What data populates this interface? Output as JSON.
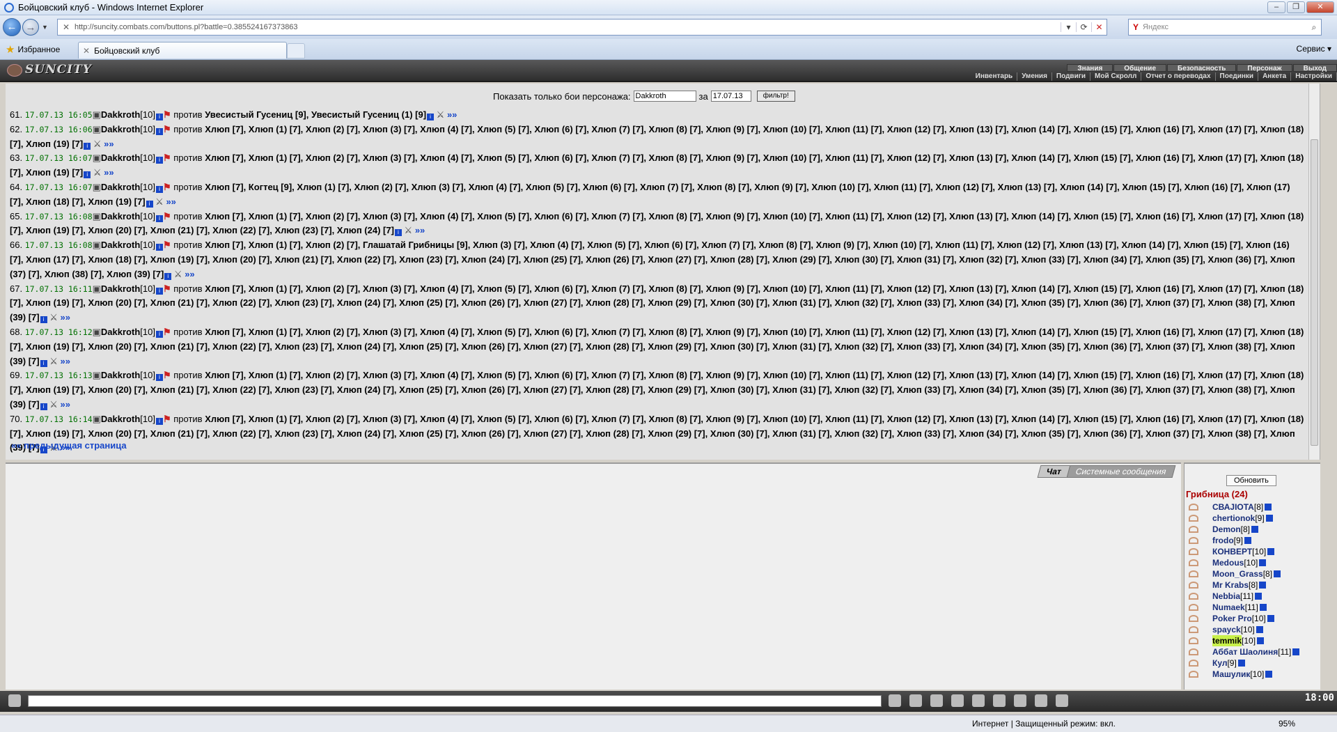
{
  "window": {
    "title": "Бойцовский клуб - Windows Internet Explorer"
  },
  "address": {
    "url": "http://suncity.combats.com/buttons.pl?battle=0.385524167373863"
  },
  "search": {
    "placeholder": "Яндекс"
  },
  "favorites": {
    "label": "Избранное"
  },
  "tab": {
    "title": "Бойцовский клуб"
  },
  "service_menu": "Сервис",
  "game": {
    "logo": "SUNCITY",
    "menu_top": [
      "Знания",
      "Общение",
      "Безопасность",
      "Персонаж",
      "Выход"
    ],
    "menu_bottom": [
      "Инвентарь",
      "Умения",
      "Подвиги",
      "Мой Скролл",
      "Отчет о переводах",
      "Поединки",
      "Анкета",
      "Настройки"
    ]
  },
  "filter": {
    "label": "Показать только бои персонажа:",
    "name": "Dakkroth",
    "for_label": "за",
    "date": "17.07.13",
    "button": "фильтр!"
  },
  "battles": [
    {
      "n": "61.",
      "dt": "17.07.13 16:05",
      "text": "Увесистый Гусениц [9], Увесистый Гусениц (1) [9]"
    },
    {
      "n": "62.",
      "dt": "17.07.13 16:06",
      "text": "Хлюп [7], Хлюп (1) [7], Хлюп (2) [7], Хлюп (3) [7], Хлюп (4) [7], Хлюп (5) [7], Хлюп (6) [7], Хлюп (7) [7], Хлюп (8) [7], Хлюп (9) [7], Хлюп (10) [7], Хлюп (11) [7], Хлюп (12) [7], Хлюп (13) [7], Хлюп (14) [7], Хлюп (15) [7], Хлюп (16) [7], Хлюп (17) [7], Хлюп (18) [7], Хлюп (19) [7]"
    },
    {
      "n": "63.",
      "dt": "17.07.13 16:07",
      "text": "Хлюп [7], Хлюп (1) [7], Хлюп (2) [7], Хлюп (3) [7], Хлюп (4) [7], Хлюп (5) [7], Хлюп (6) [7], Хлюп (7) [7], Хлюп (8) [7], Хлюп (9) [7], Хлюп (10) [7], Хлюп (11) [7], Хлюп (12) [7], Хлюп (13) [7], Хлюп (14) [7], Хлюп (15) [7], Хлюп (16) [7], Хлюп (17) [7], Хлюп (18) [7], Хлюп (19) [7]"
    },
    {
      "n": "64.",
      "dt": "17.07.13 16:07",
      "text": "Хлюп [7], Когтец [9], Хлюп (1) [7], Хлюп (2) [7], Хлюп (3) [7], Хлюп (4) [7], Хлюп (5) [7], Хлюп (6) [7], Хлюп (7) [7], Хлюп (8) [7], Хлюп (9) [7], Хлюп (10) [7], Хлюп (11) [7], Хлюп (12) [7], Хлюп (13) [7], Хлюп (14) [7], Хлюп (15) [7], Хлюп (16) [7], Хлюп (17) [7], Хлюп (18) [7], Хлюп (19) [7]"
    },
    {
      "n": "65.",
      "dt": "17.07.13 16:08",
      "text": "Хлюп [7], Хлюп (1) [7], Хлюп (2) [7], Хлюп (3) [7], Хлюп (4) [7], Хлюп (5) [7], Хлюп (6) [7], Хлюп (7) [7], Хлюп (8) [7], Хлюп (9) [7], Хлюп (10) [7], Хлюп (11) [7], Хлюп (12) [7], Хлюп (13) [7], Хлюп (14) [7], Хлюп (15) [7], Хлюп (16) [7], Хлюп (17) [7], Хлюп (18) [7], Хлюп (19) [7], Хлюп (20) [7], Хлюп (21) [7], Хлюп (22) [7], Хлюп (23) [7], Хлюп (24) [7]"
    },
    {
      "n": "66.",
      "dt": "17.07.13 16:08",
      "text": "Хлюп [7], Хлюп (1) [7], Хлюп (2) [7], Глашатай Грибницы [9], Хлюп (3) [7], Хлюп (4) [7], Хлюп (5) [7], Хлюп (6) [7], Хлюп (7) [7], Хлюп (8) [7], Хлюп (9) [7], Хлюп (10) [7], Хлюп (11) [7], Хлюп (12) [7], Хлюп (13) [7], Хлюп (14) [7], Хлюп (15) [7], Хлюп (16) [7], Хлюп (17) [7], Хлюп (18) [7], Хлюп (19) [7], Хлюп (20) [7], Хлюп (21) [7], Хлюп (22) [7], Хлюп (23) [7], Хлюп (24) [7], Хлюп (25) [7], Хлюп (26) [7], Хлюп (27) [7], Хлюп (28) [7], Хлюп (29) [7], Хлюп (30) [7], Хлюп (31) [7], Хлюп (32) [7], Хлюп (33) [7], Хлюп (34) [7], Хлюп (35) [7], Хлюп (36) [7], Хлюп (37) [7], Хлюп (38) [7], Хлюп (39) [7]"
    },
    {
      "n": "67.",
      "dt": "17.07.13 16:11",
      "text": "Хлюп [7], Хлюп (1) [7], Хлюп (2) [7], Хлюп (3) [7], Хлюп (4) [7], Хлюп (5) [7], Хлюп (6) [7], Хлюп (7) [7], Хлюп (8) [7], Хлюп (9) [7], Хлюп (10) [7], Хлюп (11) [7], Хлюп (12) [7], Хлюп (13) [7], Хлюп (14) [7], Хлюп (15) [7], Хлюп (16) [7], Хлюп (17) [7], Хлюп (18) [7], Хлюп (19) [7], Хлюп (20) [7], Хлюп (21) [7], Хлюп (22) [7], Хлюп (23) [7], Хлюп (24) [7], Хлюп (25) [7], Хлюп (26) [7], Хлюп (27) [7], Хлюп (28) [7], Хлюп (29) [7], Хлюп (30) [7], Хлюп (31) [7], Хлюп (32) [7], Хлюп (33) [7], Хлюп (34) [7], Хлюп (35) [7], Хлюп (36) [7], Хлюп (37) [7], Хлюп (38) [7], Хлюп (39) [7]"
    },
    {
      "n": "68.",
      "dt": "17.07.13 16:12",
      "text": "Хлюп [7], Хлюп (1) [7], Хлюп (2) [7], Хлюп (3) [7], Хлюп (4) [7], Хлюп (5) [7], Хлюп (6) [7], Хлюп (7) [7], Хлюп (8) [7], Хлюп (9) [7], Хлюп (10) [7], Хлюп (11) [7], Хлюп (12) [7], Хлюп (13) [7], Хлюп (14) [7], Хлюп (15) [7], Хлюп (16) [7], Хлюп (17) [7], Хлюп (18) [7], Хлюп (19) [7], Хлюп (20) [7], Хлюп (21) [7], Хлюп (22) [7], Хлюп (23) [7], Хлюп (24) [7], Хлюп (25) [7], Хлюп (26) [7], Хлюп (27) [7], Хлюп (28) [7], Хлюп (29) [7], Хлюп (30) [7], Хлюп (31) [7], Хлюп (32) [7], Хлюп (33) [7], Хлюп (34) [7], Хлюп (35) [7], Хлюп (36) [7], Хлюп (37) [7], Хлюп (38) [7], Хлюп (39) [7]"
    },
    {
      "n": "69.",
      "dt": "17.07.13 16:13",
      "text": "Хлюп [7], Хлюп (1) [7], Хлюп (2) [7], Хлюп (3) [7], Хлюп (4) [7], Хлюп (5) [7], Хлюп (6) [7], Хлюп (7) [7], Хлюп (8) [7], Хлюп (9) [7], Хлюп (10) [7], Хлюп (11) [7], Хлюп (12) [7], Хлюп (13) [7], Хлюп (14) [7], Хлюп (15) [7], Хлюп (16) [7], Хлюп (17) [7], Хлюп (18) [7], Хлюп (19) [7], Хлюп (20) [7], Хлюп (21) [7], Хлюп (22) [7], Хлюп (23) [7], Хлюп (24) [7], Хлюп (25) [7], Хлюп (26) [7], Хлюп (27) [7], Хлюп (28) [7], Хлюп (29) [7], Хлюп (30) [7], Хлюп (31) [7], Хлюп (32) [7], Хлюп (33) [7], Хлюп (34) [7], Хлюп (35) [7], Хлюп (36) [7], Хлюп (37) [7], Хлюп (38) [7], Хлюп (39) [7]"
    },
    {
      "n": "70.",
      "dt": "17.07.13 16:14",
      "text": "Хлюп [7], Хлюп (1) [7], Хлюп (2) [7], Хлюп (3) [7], Хлюп (4) [7], Хлюп (5) [7], Хлюп (6) [7], Хлюп (7) [7], Хлюп (8) [7], Хлюп (9) [7], Хлюп (10) [7], Хлюп (11) [7], Хлюп (12) [7], Хлюп (13) [7], Хлюп (14) [7], Хлюп (15) [7], Хлюп (16) [7], Хлюп (17) [7], Хлюп (18) [7], Хлюп (19) [7], Хлюп (20) [7], Хлюп (21) [7], Хлюп (22) [7], Хлюп (23) [7], Хлюп (24) [7], Хлюп (25) [7], Хлюп (26) [7], Хлюп (27) [7], Хлюп (28) [7], Хлюп (29) [7], Хлюп (30) [7], Хлюп (31) [7], Хлюп (32) [7], Хлюп (33) [7], Хлюп (34) [7], Хлюп (35) [7], Хлюп (36) [7], Хлюп (37) [7], Хлюп (38) [7], Хлюп (39) [7]"
    }
  ],
  "battle_player": {
    "name": "Dakkroth",
    "level": "[10]",
    "versus": "против",
    "more": "»»"
  },
  "prev_page": "«« предыдущая страница",
  "chat_tabs": [
    "Чат",
    "Системные сообщения"
  ],
  "users": {
    "refresh": "Обновить",
    "location": "Грибница (24)",
    "list": [
      {
        "name": "СВАJIOTA",
        "lv": "[8]"
      },
      {
        "name": "chertionok",
        "lv": "[9]"
      },
      {
        "name": "Demon",
        "lv": "[8]"
      },
      {
        "name": "frodo",
        "lv": "[9]"
      },
      {
        "name": "КОНВЕРТ",
        "lv": "[10]"
      },
      {
        "name": "Medous",
        "lv": "[10]"
      },
      {
        "name": "Moon_Grass",
        "lv": "[8]"
      },
      {
        "name": "Mr Krabs",
        "lv": "[8]"
      },
      {
        "name": "Nebbia",
        "lv": "[11]"
      },
      {
        "name": "Numaek",
        "lv": "[11]"
      },
      {
        "name": "Poker Pro",
        "lv": "[10]"
      },
      {
        "name": "spayck",
        "lv": "[10]"
      },
      {
        "name": "temmik",
        "lv": "[10]"
      },
      {
        "name": "Аббат Шаолиня",
        "lv": "[11]"
      },
      {
        "name": "Кул",
        "lv": "[9]"
      },
      {
        "name": "Машулик",
        "lv": "[10]"
      }
    ]
  },
  "clock": "18:00",
  "status": {
    "zone": "Интернет | Защищенный режим: вкл.",
    "zoom": "95%"
  }
}
